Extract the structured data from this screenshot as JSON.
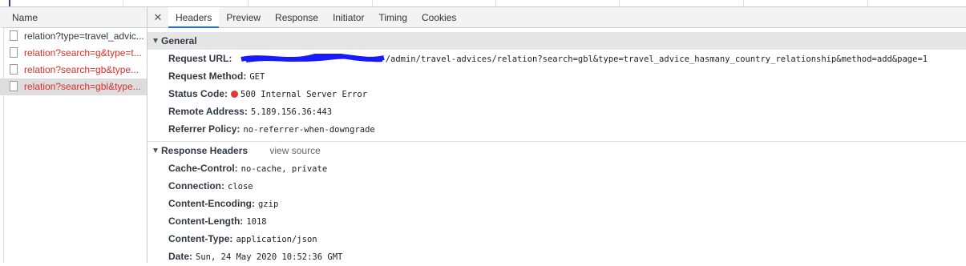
{
  "list": {
    "header": "Name",
    "rows": [
      {
        "label": "relation?type=travel_advic..."
      },
      {
        "label": "relation?search=g&type=t..."
      },
      {
        "label": "relation?search=gb&type..."
      },
      {
        "label": "relation?search=gbl&type..."
      }
    ]
  },
  "tabs": [
    "Headers",
    "Preview",
    "Response",
    "Initiator",
    "Timing",
    "Cookies"
  ],
  "general": {
    "title": "General",
    "request_url_label": "Request URL:",
    "request_url_value": "/admin/travel-advices/relation?search=gbl&type=travel_advice_hasmany_country_relationship&method=add&page=1",
    "request_method_label": "Request Method:",
    "request_method_value": "GET",
    "status_code_label": "Status Code:",
    "status_code_value": "500 Internal Server Error",
    "remote_address_label": "Remote Address:",
    "remote_address_value": "5.189.156.36:443",
    "referrer_policy_label": "Referrer Policy:",
    "referrer_policy_value": "no-referrer-when-downgrade"
  },
  "response_headers": {
    "title": "Response Headers",
    "view_source": "view source",
    "items": [
      {
        "key": "Cache-Control:",
        "value": "no-cache, private"
      },
      {
        "key": "Connection:",
        "value": "close"
      },
      {
        "key": "Content-Encoding:",
        "value": "gzip"
      },
      {
        "key": "Content-Length:",
        "value": "1018"
      },
      {
        "key": "Content-Type:",
        "value": "application/json"
      },
      {
        "key": "Date:",
        "value": "Sun, 24 May 2020 10:52:36 GMT"
      }
    ]
  },
  "colors": {
    "error": "#d93025",
    "status_dot": "#e53935",
    "redaction": "#1a1aff"
  },
  "icons": [
    "close-icon",
    "file-icon",
    "triangle-down-icon",
    "status-dot-icon"
  ]
}
